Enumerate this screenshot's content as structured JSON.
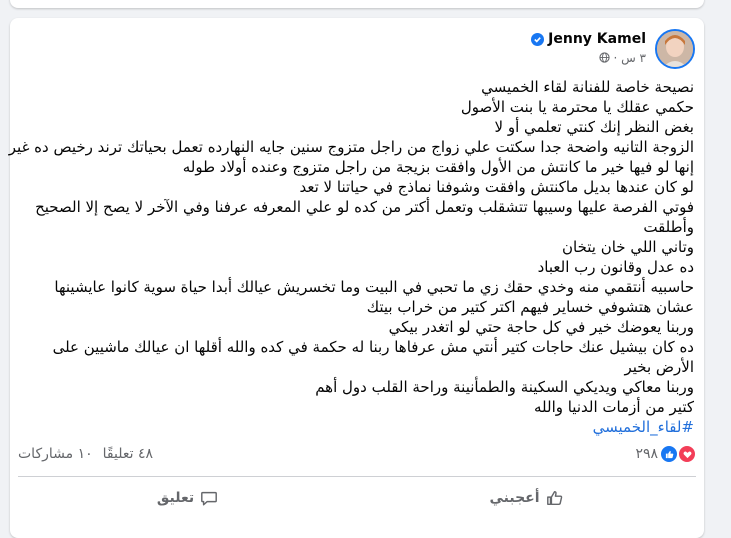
{
  "post": {
    "author": "Jenny Kamel",
    "time": "٣ س ·",
    "lines": [
      "نصيحة خاصة للفنانة لقاء الخميسي",
      "حكمي عقلك يا محترمة يا بنت الأصول",
      "بغض النظر إنك كنتي تعلمي أو لا",
      "الزوجة التانيه واضحة جدا سكتت علي زواج من راجل متزوج سنين جايه النهارده تعمل بحياتك ترند رخيص ده غير",
      "إنها لو فيها خير ما كانتش من الأول وافقت بزيجة من راجل متزوج وعنده أولاد طوله",
      "لو كان عندها بديل ماكنتش وافقت وشوفنا نماذج في حياتنا لا تعد",
      "فوتي الفرصة عليها وسيبها تتشقلب وتعمل أكتر من كده لو علي المعرفه عرفنا وفي الآخر لا يصح إلا الصحيح وأطلقت",
      "وتاني اللي خان يتخان",
      "ده عدل وقانون رب العباد",
      "حاسبيه أنتقمي  منه وخدي حقك زي ما تحبي في البيت وما تخسريش عيالك أبدا حياة سوية كانوا عايشينها",
      "عشان هتشوفي خساير فيهم اكتر كتير من خراب بيتك",
      "وربنا يعوضك خير في كل حاجة حتي لو اتغدر بيكي",
      "ده كان بيشيل عنك حاجات كتير أنتي مش عرفاها ربنا له حكمة في كده والله أقلها ان عيالك ماشيين على الأرض بخير",
      "وربنا معاكي ويديكي السكينة والطمأنينة وراحة القلب دول أهم",
      "كتير من أزمات الدنيا والله"
    ],
    "hashtag": "#لقاء_الخميسي"
  },
  "stats": {
    "reactions_count": "٢٩٨",
    "comments": "٤٨ تعليقًا",
    "shares": "١٠ مشاركات"
  },
  "actions": {
    "like_label": "أعجبني",
    "comment_label": "تعليق"
  },
  "colors": {
    "facebook_blue": "#1877f2",
    "love_red": "#f33e58",
    "hashtag_blue": "#216fdb",
    "secondary_text": "#65676b"
  },
  "icons": [
    "verified-badge-icon",
    "globe-icon",
    "like-reaction-icon",
    "love-reaction-icon",
    "thumbs-up-icon",
    "comment-icon"
  ]
}
